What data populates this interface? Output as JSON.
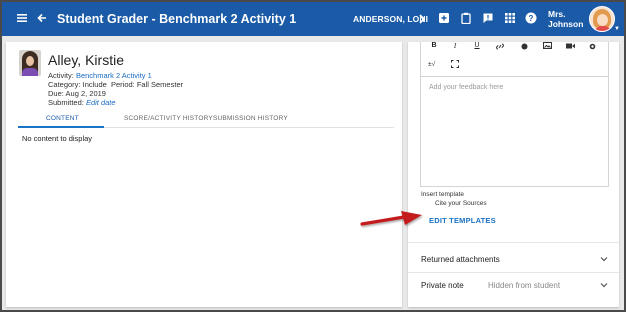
{
  "topbar": {
    "title": "Student Grader - Benchmark 2 Activity 1",
    "student": "ANDERSON, LONI",
    "user_line1": "Mrs.",
    "user_line2": "Johnson",
    "icons": [
      "menu-icon",
      "back-arrow-icon",
      "next-chevron-icon",
      "add-icon",
      "clipboard-icon",
      "feedback-icon",
      "apps-grid-icon",
      "help-icon"
    ],
    "bar_color": "#1a5aa6"
  },
  "student": {
    "name": "Alley, Kirstie",
    "activity_label": "Activity:",
    "activity_value": "Benchmark 2 Activity 1",
    "category_label": "Category:",
    "category_value": "Include",
    "period_label": "Period:",
    "period_value": "Fall Semester",
    "due_label": "Due:",
    "due_value": "Aug 2, 2019",
    "submitted_label": "Submitted:",
    "submitted_value": "Edit date"
  },
  "tabs": [
    "CONTENT",
    "SCORE/ACTIVITY HISTORY",
    "SUBMISSION HISTORY"
  ],
  "content": {
    "empty": "No content to display"
  },
  "editor": {
    "toolbar": [
      "B",
      "I",
      "U",
      "link-icon",
      "color-icon",
      "image-icon",
      "video-icon",
      "record-icon",
      "formula-icon",
      "fullscreen-icon"
    ],
    "placeholder": "Add your feedback here"
  },
  "templates": {
    "insert_label": "Insert template",
    "item": "Cite your Sources",
    "edit_link": "EDIT TEMPLATES"
  },
  "attachments": {
    "label": "Returned attachments"
  },
  "private_note": {
    "label": "Private note",
    "value": "Hidden from student"
  },
  "accent_color": "#1a73c4",
  "annotation_color": "#c41e1e"
}
